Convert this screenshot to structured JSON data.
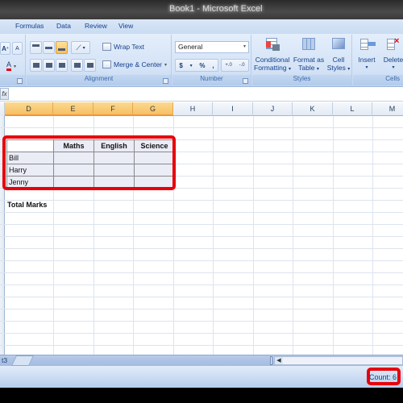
{
  "window": {
    "title": "Book1 - Microsoft Excel"
  },
  "ribbon_tabs": [
    "Formulas",
    "Data",
    "Review",
    "View"
  ],
  "ribbon": {
    "font_group": {
      "grow_font_icon": "font-grow-icon",
      "shrink_font_icon": "font-shrink-icon",
      "font_color_icon": "font-color-icon",
      "font_color": "#e8000b"
    },
    "alignment": {
      "label": "Alignment",
      "wrap_text": "Wrap Text",
      "merge_center": "Merge & Center"
    },
    "number": {
      "label": "Number",
      "format": "General",
      "currency": "$",
      "percent": "%",
      "comma": ",",
      "increase_decimal": "+.0",
      "decrease_decimal": "-.0"
    },
    "styles": {
      "label": "Styles",
      "conditional_1": "Conditional",
      "conditional_2": "Formatting",
      "format_table_1": "Format as",
      "format_table_2": "Table",
      "cell_styles_1": "Cell",
      "cell_styles_2": "Styles"
    },
    "cells": {
      "label": "Cells",
      "insert": "Insert",
      "delete": "Delete"
    }
  },
  "formula_bar": {
    "fx": "fx",
    "value": ""
  },
  "columns": [
    "D",
    "E",
    "F",
    "G",
    "H",
    "I",
    "J",
    "K",
    "L",
    "M"
  ],
  "selected_columns": [
    "D",
    "E",
    "F",
    "G"
  ],
  "table": {
    "headers": [
      "",
      "Maths",
      "English",
      "Science"
    ],
    "rows": [
      {
        "name": "Bill",
        "values": [
          "",
          "",
          ""
        ]
      },
      {
        "name": "Harry",
        "values": [
          "",
          "",
          ""
        ]
      },
      {
        "name": "Jenny",
        "values": [
          "",
          "",
          ""
        ]
      }
    ]
  },
  "total_label": "Total Marks",
  "sheet_tabs": {
    "partial_tab": "t3"
  },
  "status": {
    "count": "Count: 6"
  },
  "highlight_color": "#e8000b"
}
